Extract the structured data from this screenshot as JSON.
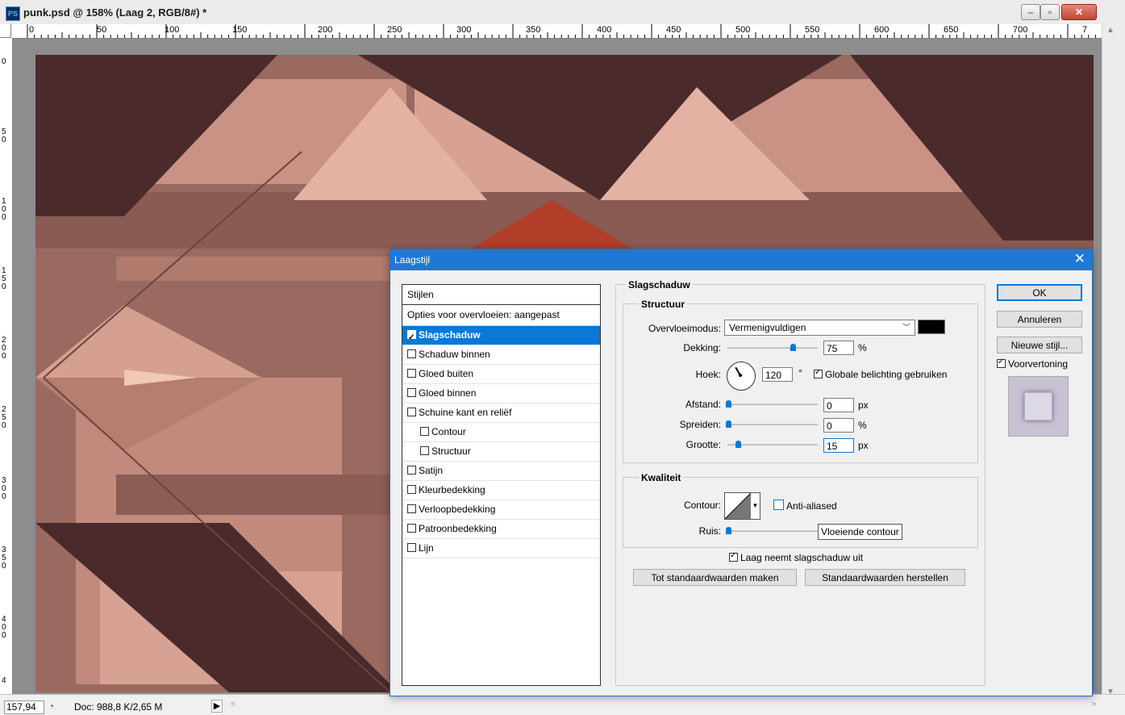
{
  "window": {
    "app_icon": "PS",
    "title": "punk.psd @ 158% (Laag 2, RGB/8#) *",
    "buttons": {
      "minimize": "–",
      "maximize": "▫",
      "close": "✕"
    }
  },
  "ruler": {
    "top": [
      "0",
      "50",
      "100",
      "150",
      "200",
      "250",
      "300",
      "350",
      "400",
      "450",
      "500",
      "550",
      "600",
      "650",
      "700",
      "7"
    ],
    "left": [
      "0",
      "50",
      "100",
      "150",
      "200",
      "250",
      "300",
      "350",
      "400",
      "4"
    ]
  },
  "status": {
    "zoom": "157,94",
    "doc_info": "Doc: 988,8 K/2,65 M",
    "arrow": "▶"
  },
  "dialog": {
    "title": "Laagstijl",
    "styles_header": "Stijlen",
    "blend_options": "Opties voor overvloeien: aangepast",
    "styles": [
      {
        "label": "Slagschaduw",
        "checked": true
      },
      {
        "label": "Schaduw binnen",
        "checked": false
      },
      {
        "label": "Gloed buiten",
        "checked": false
      },
      {
        "label": "Gloed binnen",
        "checked": false
      },
      {
        "label": "Schuine kant en reliëf",
        "checked": false
      },
      {
        "label": "Contour",
        "checked": false
      },
      {
        "label": "Structuur",
        "checked": false
      },
      {
        "label": "Satijn",
        "checked": false
      },
      {
        "label": "Kleurbedekking",
        "checked": false
      },
      {
        "label": "Verloopbedekking",
        "checked": false
      },
      {
        "label": "Patroonbedekking",
        "checked": false
      },
      {
        "label": "Lijn",
        "checked": false
      }
    ],
    "section_title": "Slagschaduw",
    "structure": {
      "legend": "Structuur",
      "blend_mode_label": "Overvloeimodus:",
      "blend_mode_value": "Vermenigvuldigen",
      "shadow_color": "#000000",
      "opacity_label": "Dekking:",
      "opacity_value": "75",
      "opacity_unit": "%",
      "opacity_level": 0.75,
      "angle_label": "Hoek:",
      "angle_value": "120",
      "angle_unit": "°",
      "global_light_label": "Globale belichting gebruiken",
      "global_light_checked": true,
      "distance_label": "Afstand:",
      "distance_value": "0",
      "distance_unit": "px",
      "spread_label": "Spreiden:",
      "spread_value": "0",
      "spread_unit": "%",
      "size_label": "Grootte:",
      "size_value": "15",
      "size_unit": "px"
    },
    "quality": {
      "legend": "Kwaliteit",
      "contour_label": "Contour:",
      "anti_aliased_label": "Anti-aliased",
      "anti_aliased_checked": false,
      "noise_label": "Ruis:",
      "tooltip": "Vloeiende contour"
    },
    "knocks_out_label": "Laag neemt slagschaduw uit",
    "knocks_out_checked": true,
    "btn_make_default": "Tot standaardwaarden maken",
    "btn_reset_default": "Standaardwaarden herstellen",
    "btn_ok": "OK",
    "btn_cancel": "Annuleren",
    "btn_new_style": "Nieuwe stijl...",
    "preview_label": "Voorvertoning",
    "preview_checked": true,
    "close": "✕"
  },
  "colors": {
    "accent": "#0a78d7",
    "dialog_title_bar": "#1e79d6",
    "art_dark": "#4a2a2b",
    "art_mid": "#9a6a61",
    "art_light": "#d9a293"
  }
}
